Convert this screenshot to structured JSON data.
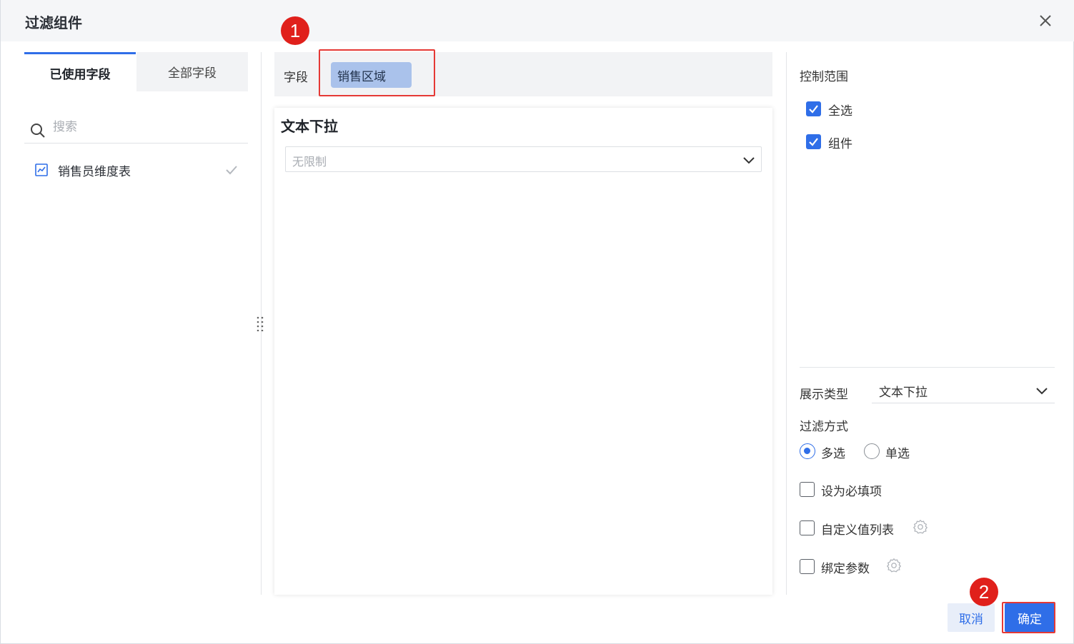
{
  "dialog": {
    "title": "过滤组件",
    "close_icon": "close-icon"
  },
  "left": {
    "tabs": [
      {
        "label": "已使用字段",
        "active": true
      },
      {
        "label": "全部字段",
        "active": false
      }
    ],
    "search": {
      "placeholder": "搜索",
      "value": ""
    },
    "tree": [
      {
        "label": "销售员维度表",
        "icon": "chart-table-icon",
        "checked": true
      }
    ]
  },
  "middle": {
    "field_label": "字段",
    "field_chip": "销售区域",
    "preview_title": "文本下拉",
    "preview_select_placeholder": "无限制"
  },
  "annotations": {
    "badge1": "1",
    "badge2": "2",
    "color": "#e0201b"
  },
  "right": {
    "scope_label": "控制范围",
    "scope_options": [
      {
        "label": "全选",
        "checked": true
      },
      {
        "label": "组件",
        "checked": true
      }
    ],
    "display_type_label": "展示类型",
    "display_type_value": "文本下拉",
    "filter_mode_label": "过滤方式",
    "filter_modes": [
      {
        "label": "多选",
        "selected": true
      },
      {
        "label": "单选",
        "selected": false
      }
    ],
    "options": [
      {
        "label": "设为必填项",
        "checked": false
      },
      {
        "label": "自定义值列表",
        "checked": false,
        "gear": true
      },
      {
        "label": "绑定参数",
        "checked": false,
        "gear": true
      }
    ]
  },
  "footer": {
    "cancel_label": "取消",
    "ok_label": "确定"
  },
  "colors": {
    "accent": "#2f6ee8",
    "chip": "#aac2eb",
    "highlight": "#e53935"
  }
}
